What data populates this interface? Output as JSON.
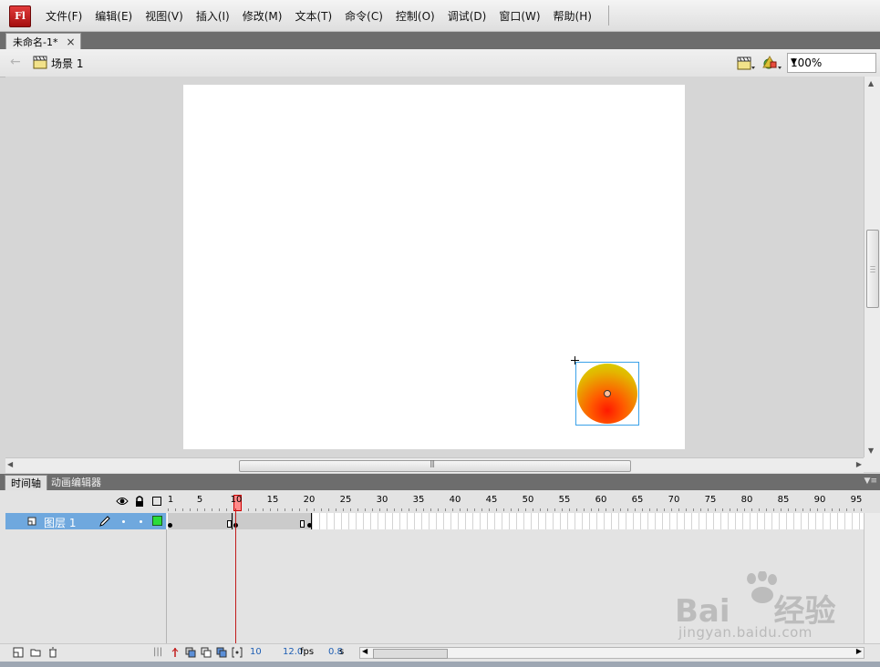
{
  "app": {
    "logo": "Fl"
  },
  "menu": [
    "文件(F)",
    "编辑(E)",
    "视图(V)",
    "插入(I)",
    "修改(M)",
    "文本(T)",
    "命令(C)",
    "控制(O)",
    "调试(D)",
    "窗口(W)",
    "帮助(H)"
  ],
  "document": {
    "tab_title": "未命名-1*",
    "close": "×"
  },
  "edit_bar": {
    "scene": "场景 1",
    "zoom": "100%"
  },
  "timeline": {
    "tabs": [
      "时间轴",
      "动画编辑器"
    ],
    "ruler": [
      "1",
      "5",
      "10",
      "15",
      "20",
      "25",
      "30",
      "35",
      "40",
      "45",
      "50",
      "55",
      "60",
      "65",
      "70",
      "75",
      "80",
      "85",
      "90",
      "95"
    ],
    "layer_name": "图层 1",
    "current_frame": 10,
    "span_end_frame": 20,
    "mid_end_frame": 18
  },
  "status": {
    "frame": "10",
    "fps": "12.0",
    "fps_unit": "fps",
    "time": "0.8",
    "time_unit": "s"
  },
  "watermark": {
    "brand": "Bai",
    "brand2": "经验",
    "url": "jingyan.baidu.com"
  },
  "colors": {
    "accent": "#6fa8de",
    "playhead": "#c21b1b",
    "ball_center": "#ff1a00",
    "ball_edge": "#cfe200"
  }
}
